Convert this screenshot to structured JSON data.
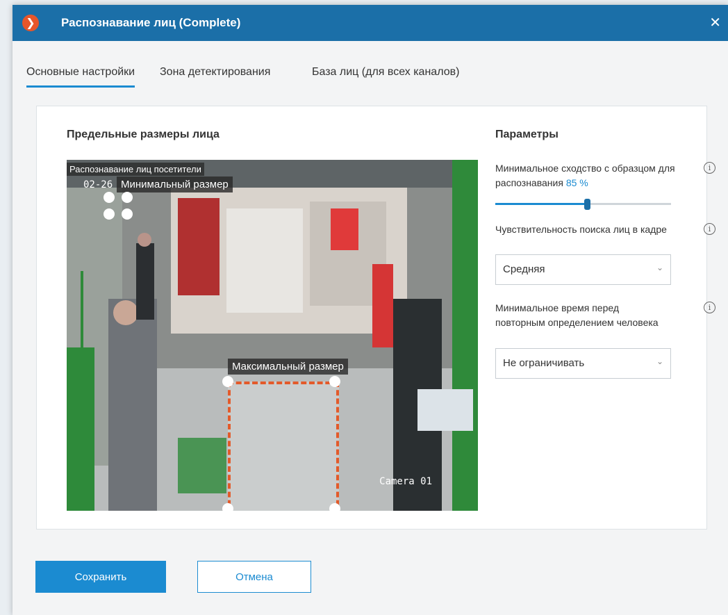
{
  "window": {
    "title": "Распознавание лиц (Complete)",
    "close_glyph": "✕",
    "logo_glyph": "❯"
  },
  "tabs": [
    {
      "label": "Основные настройки",
      "active": true
    },
    {
      "label": "Зона детектирования",
      "active": false
    },
    {
      "label": "База лиц (для всех каналов)",
      "active": false
    }
  ],
  "face_sizes": {
    "title": "Предельные размеры лица",
    "camera_label": "Распознавание лиц посетители",
    "camera_date": "02-26",
    "camera_id": "Camera 01",
    "min_size_label": "Минимальный размер",
    "max_size_label": "Максимальный размер"
  },
  "params": {
    "title": "Параметры",
    "similarity": {
      "label": "Минимальное сходство с образцом для распознавания",
      "value": "85",
      "unit": "%",
      "fraction": 0.52
    },
    "sensitivity": {
      "label": "Чувствительность поиска лиц в кадре",
      "selected": "Средняя"
    },
    "min_time": {
      "label": "Минимальное время перед повторным определением человека",
      "selected": "Не ограничивать"
    },
    "info_glyph": "i",
    "chevron_glyph": "⌄"
  },
  "buttons": {
    "save": "Сохранить",
    "cancel": "Отмена"
  },
  "colors": {
    "titlebar": "#1b6fa8",
    "accent": "#1b8bd1",
    "max_box": "#e35a2a"
  }
}
